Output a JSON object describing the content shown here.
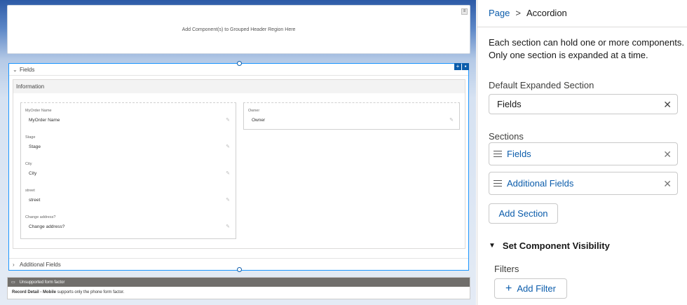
{
  "canvas": {
    "header_region_text": "Add Component(s) to Grouped Header Region Here",
    "accordion": {
      "section_fields_title": "Fields",
      "info_title": "Information",
      "left_fields": [
        {
          "label": "MyOrder Name",
          "value": "MyOrder Name"
        },
        {
          "label": "Stage",
          "value": "Stage"
        },
        {
          "label": "City",
          "value": "City"
        },
        {
          "label": "street",
          "value": "street"
        },
        {
          "label": "Change address?",
          "value": "Change address?"
        }
      ],
      "right_fields": [
        {
          "label": "Owner",
          "value": "Owner"
        }
      ],
      "section_additional_title": "Additional Fields"
    },
    "unsupported": {
      "title": "Unsupported form factor",
      "msg_bold": "Record Detail - Mobile",
      "msg_rest": " supports only the phone form factor."
    }
  },
  "panel": {
    "breadcrumb_page": "Page",
    "breadcrumb_sep": ">",
    "breadcrumb_current": "Accordion",
    "description": "Each section can hold one or more components. Only one section is expanded at a time.",
    "default_label": "Default Expanded Section",
    "default_value": "Fields",
    "sections_label": "Sections",
    "sections": [
      "Fields",
      "Additional Fields"
    ],
    "add_section": "Add Section",
    "visibility_title": "Set Component Visibility",
    "filters_label": "Filters",
    "add_filter": "Add Filter"
  }
}
